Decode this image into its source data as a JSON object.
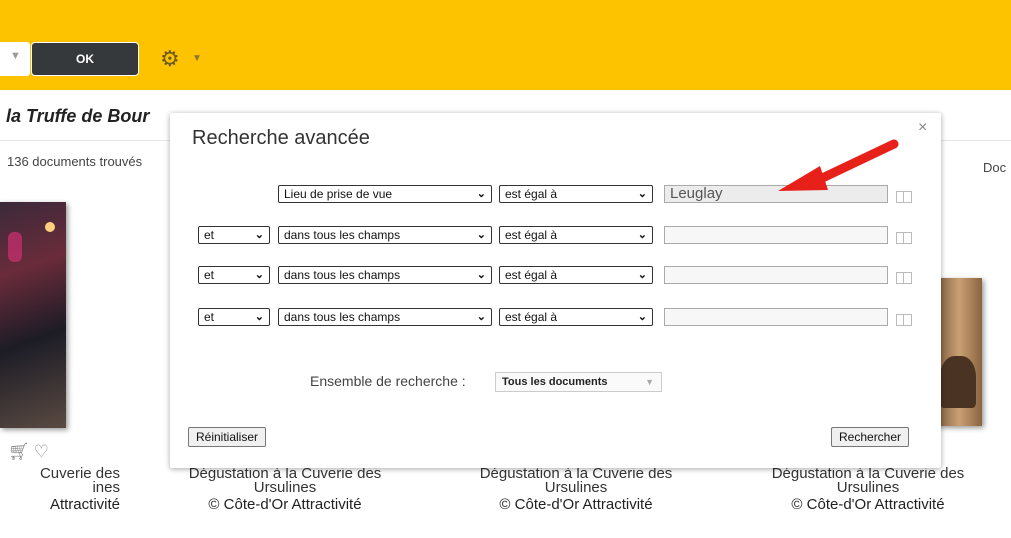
{
  "header": {
    "ok_label": "OK"
  },
  "page": {
    "title": "la Truffe de Bour",
    "doc_count": "136 documents trouvés",
    "right_fragment": "Doc"
  },
  "results": [
    {
      "title": "Cuverie des",
      "subtitle": "ines",
      "credit": "Attractivité"
    },
    {
      "title": "Dégustation à la Cuverie des",
      "subtitle": "Ursulines",
      "credit": "© Côte-d'Or Attractivité"
    },
    {
      "title": "Dégustation à la Cuverie des",
      "subtitle": "Ursulines",
      "credit": "© Côte-d'Or Attractivité"
    },
    {
      "title": "Dégustation à la Cuverie des",
      "subtitle": "Ursulines",
      "credit": "© Côte-d'Or Attractivité"
    }
  ],
  "modal": {
    "title": "Recherche avancée",
    "close": "×",
    "rows": [
      {
        "operator": "",
        "field": "Lieu de prise de vue",
        "condition": "est égal à",
        "value": "Leuglay"
      },
      {
        "operator": "et",
        "field": "dans tous les champs",
        "condition": "est égal à",
        "value": ""
      },
      {
        "operator": "et",
        "field": "dans tous les champs",
        "condition": "est égal à",
        "value": ""
      },
      {
        "operator": "et",
        "field": "dans tous les champs",
        "condition": "est égal à",
        "value": ""
      }
    ],
    "ensemble_label": "Ensemble de recherche :",
    "ensemble_value": "Tous les documents",
    "reset_label": "Réinitialiser",
    "search_label": "Rechercher"
  },
  "colors": {
    "header_bg": "#fdc300",
    "arrow": "#e8201a",
    "ok_bg": "#36393b"
  }
}
